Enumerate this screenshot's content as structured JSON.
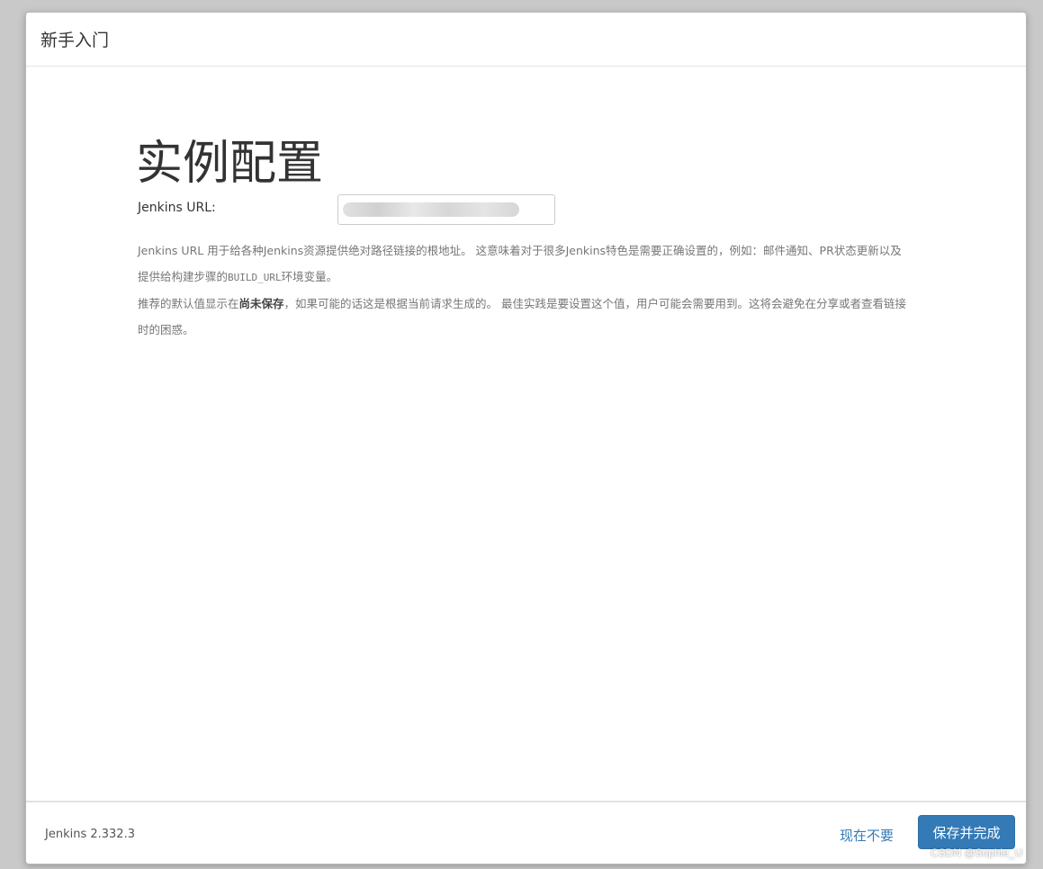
{
  "dialog": {
    "title": "新手入门"
  },
  "main": {
    "heading": "实例配置",
    "url_label": "Jenkins URL:",
    "url_value": "",
    "help": {
      "line1_a": "Jenkins URL 用于给各种Jenkins资源提供绝对路径链接的根地址。 这意味着对于很多Jenkins特色是需要正确设置的，例如：邮件通知、PR状态更新以及提供给构建步骤的",
      "line1_code": "BUILD_URL",
      "line1_b": "环境变量。",
      "line2_a": "推荐的默认值显示在",
      "line2_bold": "尚未保存",
      "line2_b": "，如果可能的话这是根据当前请求生成的。 最佳实践是要设置这个值，用户可能会需要用到。这将会避免在分享或者查看链接时的困惑。"
    }
  },
  "footer": {
    "version": "Jenkins 2.332.3",
    "skip_label": "现在不要",
    "save_label": "保存并完成"
  },
  "watermark": "CSDN @Sophie_U",
  "colors": {
    "primary": "#337ab7",
    "link": "#337ab7",
    "text": "#333333",
    "muted": "#777777"
  }
}
